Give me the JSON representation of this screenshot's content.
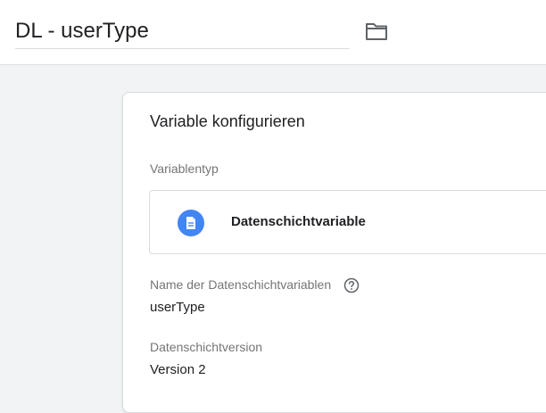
{
  "header": {
    "title": "DL - userType",
    "folder_icon": "folder-icon"
  },
  "card": {
    "title": "Variable konfigurieren",
    "type_label": "Variablentyp",
    "type_name": "Datenschichtvariable",
    "type_icon": "document-icon",
    "type_icon_color": "#4285f4",
    "name_label": "Name der Datenschichtvariablen",
    "help_icon": "help-circle-icon",
    "name_value": "userType",
    "version_label": "Datenschichtversion",
    "version_value": "Version 2"
  }
}
